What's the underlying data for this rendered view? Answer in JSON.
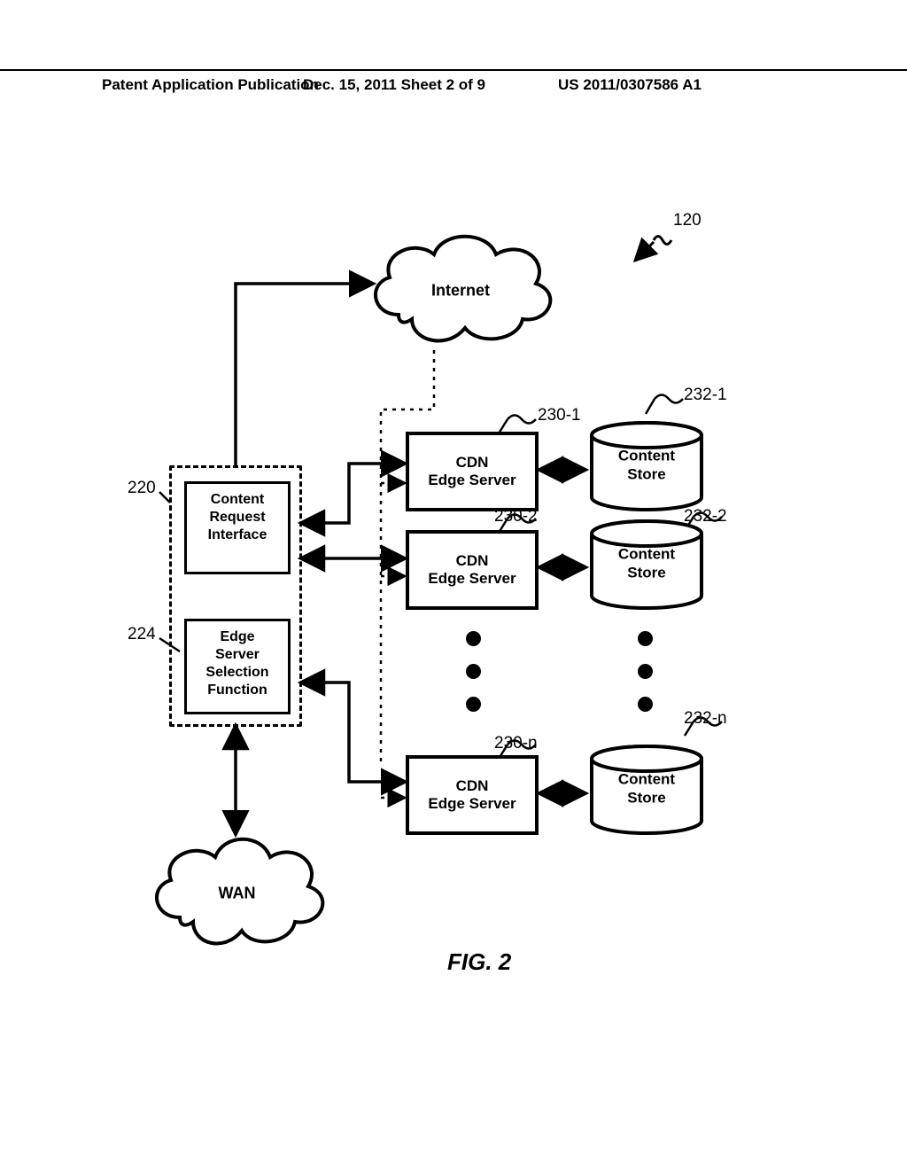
{
  "header": {
    "left": "Patent Application Publication",
    "center": "Dec. 15, 2011  Sheet 2 of 9",
    "right": "US 2011/0307586 A1"
  },
  "clouds": {
    "internet": "Internet",
    "wan": "WAN"
  },
  "interface": {
    "cri": "Content\nRequest\nInterface",
    "essf": "Edge\nServer\nSelection\nFunction"
  },
  "edge": {
    "label": "CDN\nEdge Server"
  },
  "store": {
    "label": "Content\nStore"
  },
  "refs": {
    "r120": "120",
    "r220": "220",
    "r224": "224",
    "r230_1": "230-1",
    "r230_2": "230-2",
    "r230_n": "230-n",
    "r232_1": "232-1",
    "r232_2": "232-2",
    "r232_n": "232-n"
  },
  "caption": "FIG. 2"
}
